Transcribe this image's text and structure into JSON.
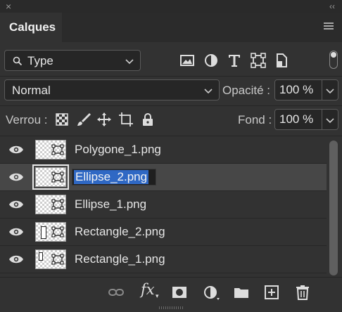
{
  "window": {
    "close_glyph": "×",
    "collapse_glyph": "‹‹"
  },
  "panel": {
    "tab_title": "Calques",
    "menu_icon": "panel-menu-icon"
  },
  "filter": {
    "search_label": "Type",
    "icons": [
      "image-filter-icon",
      "adjustment-filter-icon",
      "type-filter-icon",
      "shape-filter-icon",
      "smart-object-filter-icon"
    ],
    "toggle_on": true
  },
  "blend": {
    "mode": "Normal",
    "opacity_label": "Opacité :",
    "opacity_value": "100 %"
  },
  "lock": {
    "label": "Verrou :",
    "icons": [
      "lock-transparent-pixels-icon",
      "lock-image-pixels-icon",
      "lock-position-icon",
      "lock-artboard-icon",
      "lock-all-icon"
    ],
    "fill_label": "Fond :",
    "fill_value": "100 %"
  },
  "layers": [
    {
      "name": "Polygone_1.png",
      "visible": true,
      "selected": false,
      "editing": false
    },
    {
      "name": "Ellipse_2.png",
      "visible": true,
      "selected": true,
      "editing": true
    },
    {
      "name": "Ellipse_1.png",
      "visible": true,
      "selected": false,
      "editing": false
    },
    {
      "name": "Rectangle_2.png",
      "visible": true,
      "selected": false,
      "editing": false
    },
    {
      "name": "Rectangle_1.png",
      "visible": true,
      "selected": false,
      "editing": false
    }
  ],
  "bottom_toolbar": [
    "link-layers-icon",
    "fx-icon",
    "add-mask-icon",
    "adjustment-layer-icon",
    "new-group-icon",
    "new-layer-icon",
    "delete-layer-icon"
  ],
  "fx_text": "fx",
  "colors": {
    "panel_bg": "#323232",
    "selection_bg": "#474747",
    "text_highlight": "#2f68c4"
  }
}
